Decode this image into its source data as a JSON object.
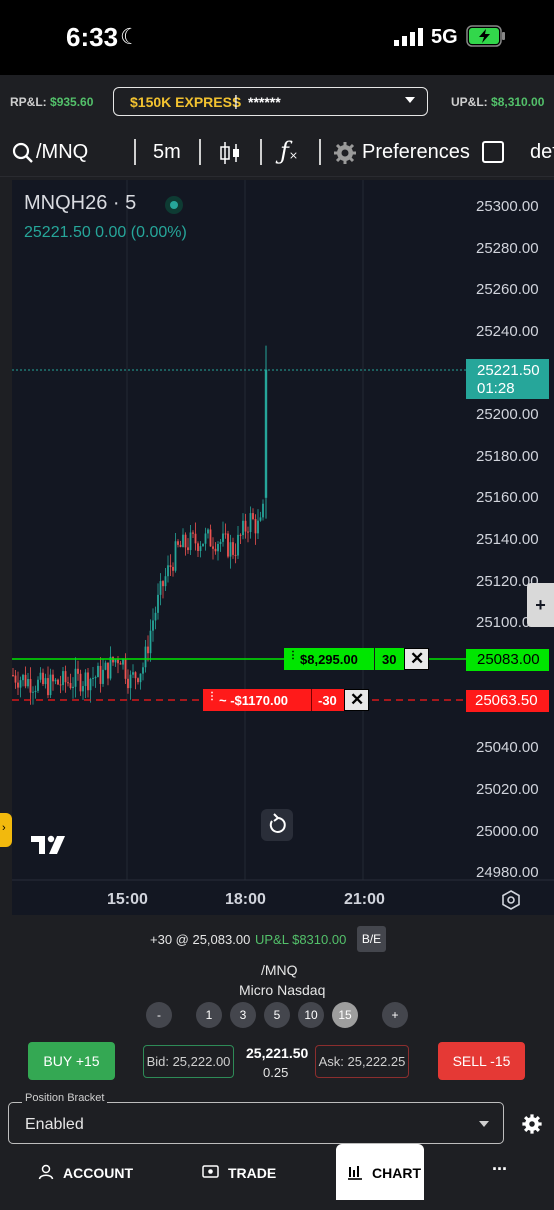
{
  "status_bar": {
    "time": "6:33",
    "network": "5G"
  },
  "account_bar": {
    "rpl_label": "RP&L:",
    "rpl_value": "$935.60",
    "account_name": "$150K EXPRESS",
    "account_separator": "|",
    "account_number": "******",
    "upl_label": "UP&L:",
    "upl_value": "$8,310.00"
  },
  "toolbar": {
    "symbol": "/MNQ",
    "interval": "5m",
    "preferences": "Preferences",
    "more": "def",
    "icons": [
      "search-icon",
      "candlestick-icon",
      "indicators-icon",
      "gear-icon"
    ]
  },
  "chart": {
    "legend_symbol": "MNQH26 · 5",
    "legend_price": "25221.50 0.00 (0.00%)",
    "y_ticks": [
      "25300.00",
      "25280.00",
      "25260.00",
      "25240.00",
      "25200.00",
      "25180.00",
      "25160.00",
      "25140.00",
      "25120.00",
      "25100.00",
      "25040.00",
      "25020.00",
      "25000.00",
      "24980.00"
    ],
    "x_ticks": [
      "15:00",
      "18:00",
      "21:00"
    ],
    "last_price": "25221.50",
    "countdown": "01:28",
    "position_price": "25083.00",
    "position_pnl": "$8,295.00",
    "position_qty": "30",
    "stop_price": "25063.50",
    "stop_pnl": "~ -$1170.00",
    "stop_qty": "-30",
    "logo": "TV",
    "colors": {
      "up": "#26a69a",
      "down": "#ef5350",
      "position_line": "#00e600",
      "stop_line": "#ff1a1a",
      "last_price_box": "#26a69a"
    }
  },
  "chart_data": {
    "type": "candlestick",
    "ylim": [
      24980,
      25300
    ],
    "x": [
      "15:00",
      "18:00",
      "21:00"
    ],
    "last_price": 25221.5,
    "position_price": 25083.0,
    "stop_price": 25063.5
  },
  "position": {
    "summary": "+30 @ 25,083.00",
    "upl": "UP&L $8310.00",
    "be_button": "B/E",
    "symbol": "/MNQ",
    "name": "Micro Nasdaq"
  },
  "quantities": [
    "-",
    "1",
    "3",
    "5",
    "10",
    "15",
    "+"
  ],
  "quantity_selected": "15",
  "order": {
    "buy": "BUY +15",
    "bid": "Bid: 25,222.00",
    "last": "25,221.50",
    "tick": "0.25",
    "ask": "Ask: 25,222.25",
    "sell": "SELL -15"
  },
  "bracket": {
    "label": "Position Bracket",
    "value": "Enabled"
  },
  "nav": {
    "account": "ACCOUNT",
    "trade": "TRADE",
    "chart": "CHART",
    "more": "..."
  }
}
